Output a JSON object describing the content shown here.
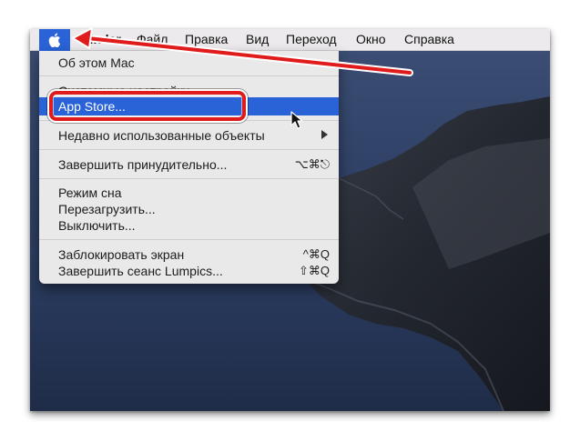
{
  "menubar": {
    "items": [
      {
        "label": "Finder"
      },
      {
        "label": "Файл"
      },
      {
        "label": "Правка"
      },
      {
        "label": "Вид"
      },
      {
        "label": "Переход"
      },
      {
        "label": "Окно"
      },
      {
        "label": "Справка"
      }
    ]
  },
  "apple_menu": {
    "items": [
      {
        "label": "Об этом Mac"
      },
      {
        "label": "Системные настройки..."
      },
      {
        "label": "App Store..."
      },
      {
        "label": "Недавно использованные объекты"
      },
      {
        "label": "Завершить принудительно...",
        "shortcut": "⌥⌘⎋"
      },
      {
        "label": "Режим сна"
      },
      {
        "label": "Перезагрузить..."
      },
      {
        "label": "Выключить..."
      },
      {
        "label": "Заблокировать экран",
        "shortcut": "^⌘Q"
      },
      {
        "label": "Завершить сеанс Lumpics...",
        "shortcut": "⇧⌘Q"
      }
    ],
    "highlighted": "App Store..."
  },
  "colors": {
    "accent": "#2a63d8",
    "annotation": "#e01b1b",
    "menubar_bg": "#eceaec",
    "menu_bg": "#eae9ea"
  },
  "icons": [
    "apple-logo-icon",
    "submenu-chevron-icon",
    "mouse-pointer-icon",
    "annotation-arrow-icon"
  ]
}
